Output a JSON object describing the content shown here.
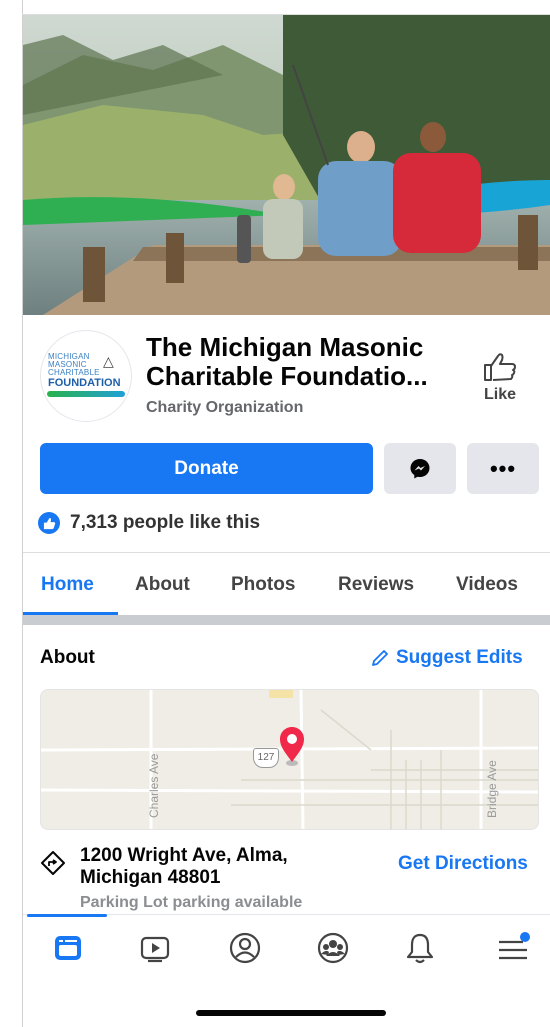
{
  "page": {
    "name": "The Michigan Masonic Charitable Foundatio...",
    "category": "Charity Organization",
    "logo_text": {
      "line1": "MICHIGAN",
      "line2": "MASONIC",
      "line3": "CHARITABLE",
      "line4": "FOUNDATION"
    }
  },
  "like_button": {
    "label": "Like"
  },
  "actions": {
    "donate_label": "Donate",
    "messenger_icon": "messenger-icon",
    "more_label": "•••"
  },
  "likes": {
    "text": "7,313 people like this"
  },
  "tabs": [
    {
      "label": "Home",
      "active": true
    },
    {
      "label": "About",
      "active": false
    },
    {
      "label": "Photos",
      "active": false
    },
    {
      "label": "Reviews",
      "active": false
    },
    {
      "label": "Videos",
      "active": false
    }
  ],
  "about": {
    "title": "About",
    "suggest_label": "Suggest Edits",
    "map": {
      "streets": [
        "Charles Ave",
        "Bridge Ave"
      ],
      "route_shield": "127"
    },
    "address": "1200 Wright Ave, Alma, Michigan 48801",
    "directions_label": "Get Directions",
    "parking": "Parking Lot parking available"
  },
  "bottom_nav": [
    {
      "icon": "news-feed-icon",
      "active": true
    },
    {
      "icon": "watch-icon",
      "active": false
    },
    {
      "icon": "profile-icon",
      "active": false
    },
    {
      "icon": "groups-icon",
      "active": false
    },
    {
      "icon": "notifications-icon",
      "active": false
    },
    {
      "icon": "menu-icon",
      "active": false,
      "badge": true
    }
  ],
  "colors": {
    "accent": "#1877f2",
    "button_gray": "#e4e6eb",
    "map_pin": "#f02849"
  }
}
